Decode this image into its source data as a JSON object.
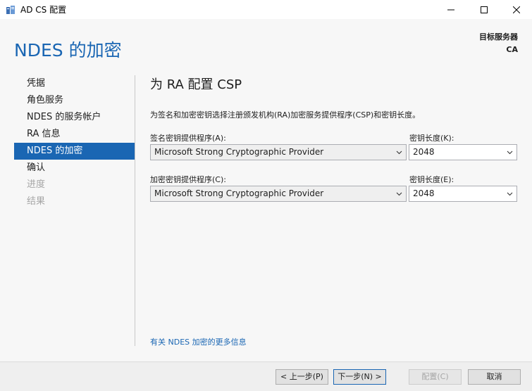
{
  "window": {
    "title": "AD CS 配置",
    "icon": "server-config-icon"
  },
  "header": {
    "page_title": "NDES 的加密",
    "destination_label": "目标服务器",
    "destination_value": "CA"
  },
  "nav": {
    "items": [
      {
        "label": "凭据",
        "state": "normal"
      },
      {
        "label": "角色服务",
        "state": "normal"
      },
      {
        "label": "NDES 的服务帐户",
        "state": "normal"
      },
      {
        "label": "RA 信息",
        "state": "normal"
      },
      {
        "label": "NDES 的加密",
        "state": "selected"
      },
      {
        "label": "确认",
        "state": "normal"
      },
      {
        "label": "进度",
        "state": "disabled"
      },
      {
        "label": "结果",
        "state": "disabled"
      }
    ]
  },
  "main": {
    "section_title": "为 RA 配置 CSP",
    "description": "为签名和加密密钥选择注册颁发机构(RA)加密服务提供程序(CSP)和密钥长度。",
    "signature": {
      "provider_label": "签名密钥提供程序(A):",
      "provider_value": "Microsoft Strong Cryptographic Provider",
      "key_length_label": "密钥长度(K):",
      "key_length_value": "2048"
    },
    "encryption": {
      "provider_label": "加密密钥提供程序(C):",
      "provider_value": "Microsoft Strong Cryptographic Provider",
      "key_length_label": "密钥长度(E):",
      "key_length_value": "2048"
    },
    "more_info_link": "有关 NDES 加密的更多信息"
  },
  "footer": {
    "back_label": "< 上一步(P)",
    "next_label": "下一步(N) >",
    "configure_label": "配置(C)",
    "cancel_label": "取消"
  },
  "colors": {
    "accent": "#1a66b3",
    "disabled_text": "#a6a6a6"
  }
}
